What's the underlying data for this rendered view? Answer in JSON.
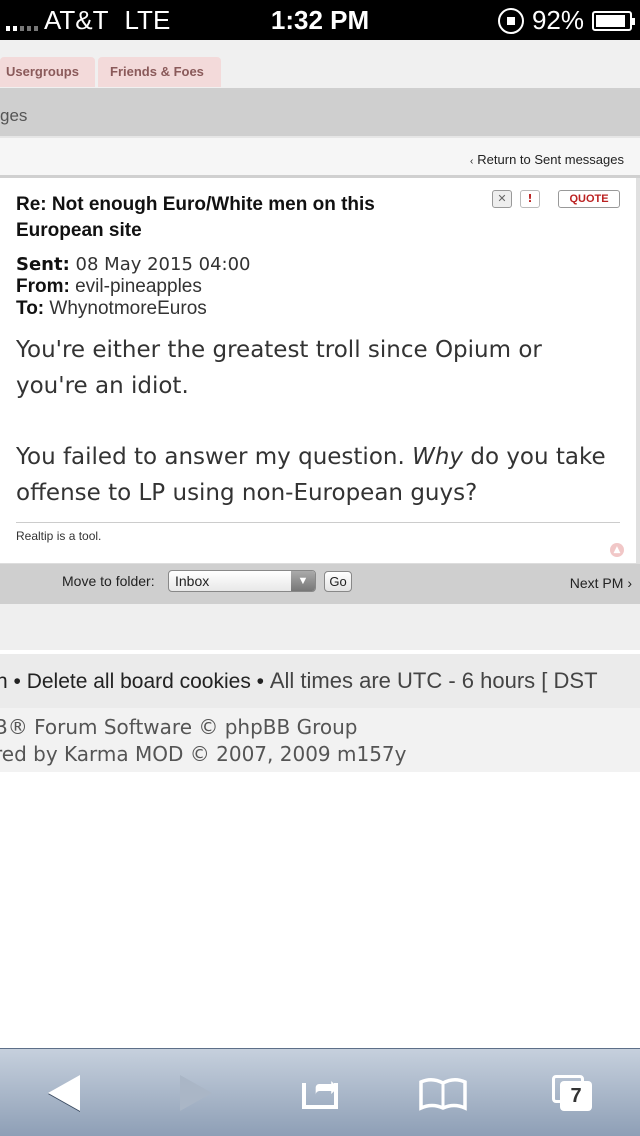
{
  "status_bar": {
    "carrier": "AT&T",
    "network": "LTE",
    "time": "1:32 PM",
    "battery": "92%",
    "battery_level": 0.92
  },
  "tabs": [
    {
      "label": "Usergroups"
    },
    {
      "label": "Friends & Foes"
    }
  ],
  "section_header": "ges",
  "return_link": "Return to Sent messages",
  "message": {
    "title": "Re: Not enough Euro/White men on this European site",
    "actions": {
      "delete_icon": "x-icon",
      "report_icon": "exclamation-icon",
      "quote_label": "QUOTE"
    },
    "sent_label": "Sent:",
    "sent_value": "08 May 2015 04:00",
    "from_label": "From:",
    "from_value": "evil-pineapples",
    "to_label": "To:",
    "to_value": "WhynotmoreEuros",
    "paragraph1": "You're either the greatest troll since Opium or you're an idiot.",
    "paragraph2_prefix": "You failed to answer my question. ",
    "paragraph2_emphasis": "Why",
    "paragraph2_suffix": " do you take offense to LP using non-European guys?",
    "signature": "Realtip is a tool."
  },
  "folder_bar": {
    "label": "Move to folder:",
    "selected": "Inbox",
    "go_label": "Go",
    "next_label": "Next PM"
  },
  "footer": {
    "links_prefix": "n • ",
    "delete_cookies": "Delete all board cookies",
    "separator": " • ",
    "timezone": "All times are UTC - 6 hours [ DST",
    "copyright_line1": "B® Forum Software © phpBB Group",
    "copyright_line2": "red by Karma MOD © 2007, 2009 m157y"
  },
  "toolbar": {
    "tab_count": "7",
    "icons": [
      "back-arrow-icon",
      "forward-arrow-icon",
      "share-icon",
      "bookmarks-icon",
      "tabs-icon"
    ]
  }
}
